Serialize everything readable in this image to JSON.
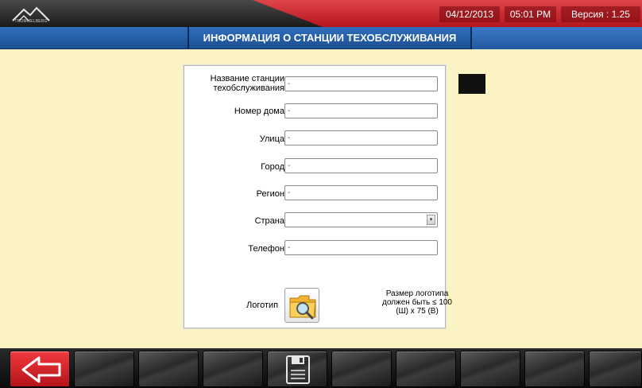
{
  "header": {
    "logo_icon": "mountain-logo-icon",
    "logo_text": "TROMMELBERG",
    "date": "04/12/2013",
    "time": "05:01 PM",
    "version": "Версия : 1.25"
  },
  "page": {
    "title": "ИНФОРМАЦИЯ О СТАНЦИИ ТЕХОБСЛУЖИВАНИЯ"
  },
  "form": {
    "fields": [
      {
        "label_line1": "Название станции",
        "label_line2": "техобслуживания",
        "value": "-"
      },
      {
        "label": "Номер дома",
        "value": "-"
      },
      {
        "label": "Улица",
        "value": "-"
      },
      {
        "label": "Город",
        "value": "-"
      },
      {
        "label": "Регион",
        "value": "-"
      },
      {
        "label": "Страна",
        "value": ""
      },
      {
        "label": "Телефон",
        "value": "-"
      }
    ],
    "logo_label": "Логотип",
    "logo_icon": "folder-search-icon",
    "logo_note": "Размер логотипа должен быть ≤ 100 (Ш) x 75 (В)"
  },
  "toolbar": {
    "buttons": [
      {
        "icon": "back-arrow-icon"
      },
      {
        "icon": ""
      },
      {
        "icon": ""
      },
      {
        "icon": ""
      },
      {
        "icon": "save-icon"
      },
      {
        "icon": ""
      },
      {
        "icon": ""
      },
      {
        "icon": ""
      },
      {
        "icon": ""
      },
      {
        "icon": ""
      }
    ]
  },
  "colors": {
    "background": "#fbf3c3",
    "header_red": "#c81e24",
    "title_blue": "#245aa3",
    "back_button_red": "#e02a30"
  }
}
